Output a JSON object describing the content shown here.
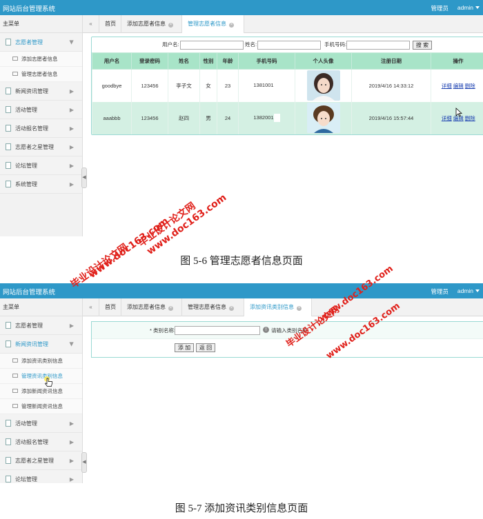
{
  "app": {
    "title": "网站后台管理系统",
    "role": "管理员",
    "user": "admin"
  },
  "sidebar": {
    "heading": "主菜单",
    "s1_items": [
      {
        "label": "志愿者管理",
        "open": true,
        "subs": [
          "添加志愿者信息",
          "管理志愿者信息"
        ]
      },
      {
        "label": "新闻资讯管理"
      },
      {
        "label": "活动管理"
      },
      {
        "label": "活动报名管理"
      },
      {
        "label": "志愿者之星管理"
      },
      {
        "label": "论坛管理"
      },
      {
        "label": "系统管理"
      }
    ],
    "s2_items": [
      {
        "label": "志愿者管理"
      },
      {
        "label": "新闻资讯管理",
        "open": true,
        "subs": [
          "添加资讯类别信息",
          "管理资讯类别信息",
          "添加新闻资讯信息",
          "管理新闻资讯信息"
        ]
      },
      {
        "label": "活动管理"
      },
      {
        "label": "活动报名管理"
      },
      {
        "label": "志愿者之星管理"
      },
      {
        "label": "论坛管理"
      }
    ]
  },
  "tabs1": [
    "首页",
    "添加志愿者信息",
    "管理志愿者信息"
  ],
  "tabs2": [
    "首页",
    "添加志愿者信息",
    "管理志愿者信息",
    "添加资讯类别信息"
  ],
  "search": {
    "username_label": "用户名:",
    "name_label": "姓名:",
    "phone_label": "手机号码:",
    "button": "搜 索"
  },
  "table": {
    "headers": [
      "用户名",
      "登录密码",
      "姓名",
      "性别",
      "年龄",
      "手机号码",
      "个人头像",
      "注册日期",
      "操作"
    ],
    "rows": [
      {
        "username": "goodbye",
        "password": "123456",
        "name": "李子文",
        "gender": "女",
        "age": "23",
        "phone": "1381001",
        "date": "2019/4/16 14:33:12"
      },
      {
        "username": "aaabbb",
        "password": "123456",
        "name": "赵四",
        "gender": "男",
        "age": "24",
        "phone": "1382001",
        "date": "2019/4/16 15:57:44"
      }
    ],
    "ops": [
      "详细",
      "编辑",
      "删除"
    ]
  },
  "form": {
    "label": "* 类别名称:",
    "hint": "请输入类别名称",
    "submit": "添 加",
    "back": "返 回"
  },
  "captions": {
    "fig1": "图 5-6 管理志愿者信息页面",
    "fig2": "图 5-7 添加资讯类别信息页面"
  },
  "watermark": {
    "cn": "毕业设计论文网",
    "url": "www.doc163.com"
  },
  "colors": {
    "topbar": "#2e98c8",
    "header_green": "#a8e4c8",
    "row_green": "#d4f0e3",
    "watermark": "#e0201a"
  }
}
